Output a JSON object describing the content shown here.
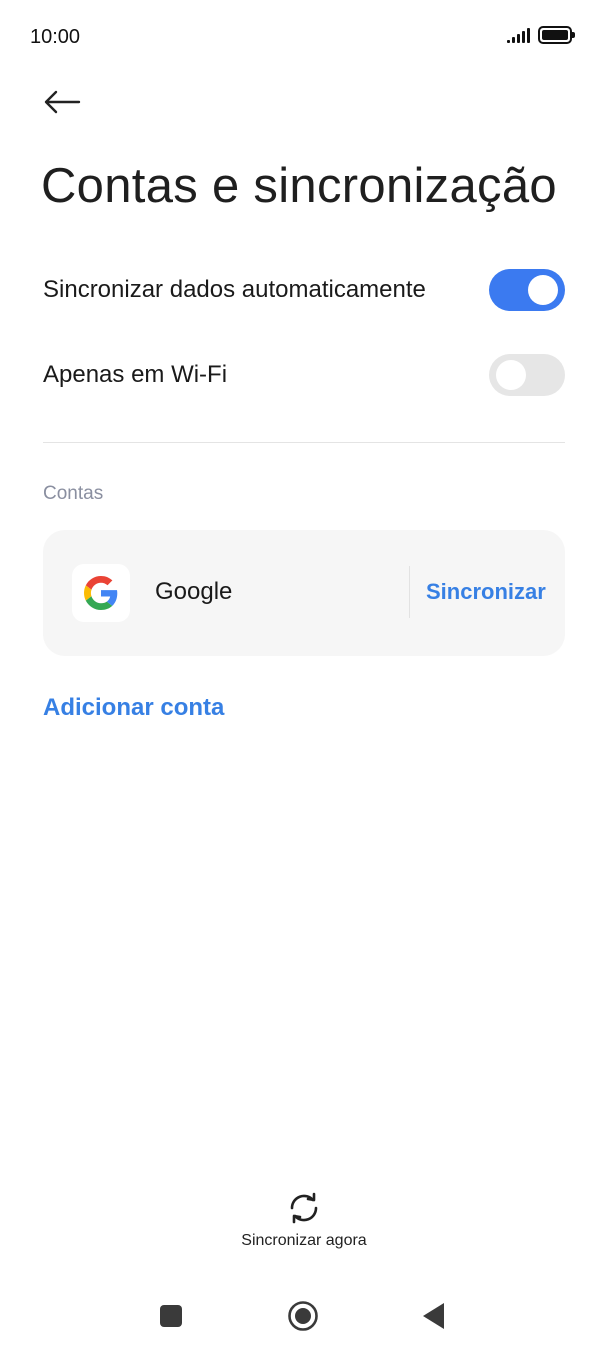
{
  "status_bar": {
    "time": "10:00",
    "icons": [
      "signal-icon",
      "battery-icon"
    ]
  },
  "header": {
    "back_icon": "arrow-left-icon",
    "title": "Contas e sincronização"
  },
  "settings": {
    "auto_sync": {
      "label": "Sincronizar dados automaticamente",
      "enabled": true
    },
    "wifi_only": {
      "label": "Apenas em Wi-Fi",
      "enabled": false
    }
  },
  "accounts": {
    "section_title": "Contas",
    "items": [
      {
        "name": "Google",
        "icon": "google-icon",
        "action_label": "Sincronizar"
      }
    ],
    "add_label": "Adicionar conta"
  },
  "footer": {
    "sync_now_icon": "sync-icon",
    "sync_now_label": "Sincronizar agora"
  },
  "nav_bar": {
    "icons": [
      "recents-square-icon",
      "home-circle-icon",
      "back-triangle-icon"
    ]
  },
  "colors": {
    "accent": "#3780e4",
    "toggle_on": "#3b7af0",
    "toggle_off": "#e6e6e6",
    "card_bg": "#f6f6f6",
    "section_header": "#8a8fa0"
  }
}
